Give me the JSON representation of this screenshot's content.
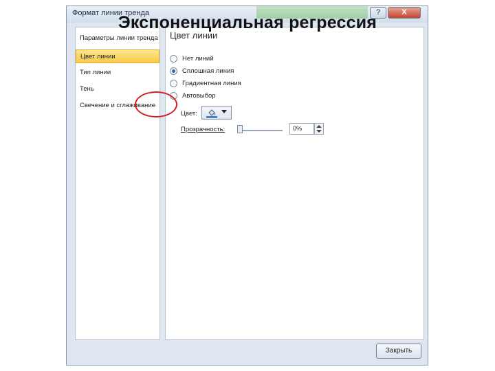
{
  "slide": {
    "title": "Экспоненциальная регрессия"
  },
  "dialog": {
    "title": "Формат линии тренда",
    "help_label": "?",
    "close_label": "X",
    "close_button": "Закрыть"
  },
  "nav": {
    "items": [
      {
        "label": "Параметры линии тренда",
        "selected": false
      },
      {
        "label": "Цвет линии",
        "selected": true
      },
      {
        "label": "Тип линии",
        "selected": false
      },
      {
        "label": "Тень",
        "selected": false
      },
      {
        "label": "Свечение и сглаживание",
        "selected": false
      }
    ]
  },
  "panel": {
    "title": "Цвет линии",
    "options": [
      {
        "label": "Нет линий",
        "checked": false
      },
      {
        "label": "Сплошная линия",
        "checked": true
      },
      {
        "label": "Градиентная линия",
        "checked": false
      },
      {
        "label": "Автовыбор",
        "checked": false
      }
    ],
    "color_label": "Цвет:",
    "color_icon": "paint-bucket-icon",
    "color_value": "#4f81bd",
    "transparency_label": "Прозрачность:",
    "transparency_value": "0%",
    "transparency_level": 0
  },
  "colors": {
    "selected_nav": "#f9c94a",
    "highlight_ring": "#d22020",
    "close_button": "#c0452e"
  }
}
